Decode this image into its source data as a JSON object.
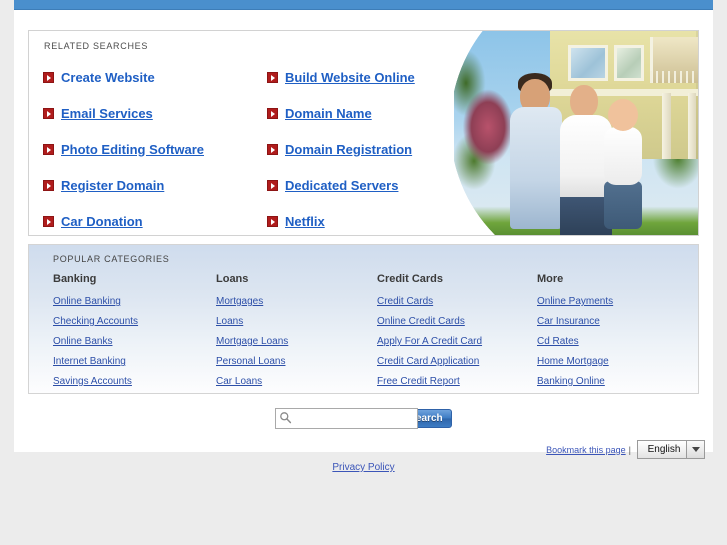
{
  "theme": {
    "topbar_color": "#4a8fcd",
    "link_color": "#1f5fc4",
    "bullet_color": "#b01c1c",
    "page_background": "#ececec",
    "panel_background": "#ffffff",
    "category_gradient_top": "#cfdced",
    "category_gradient_bottom": "#fdfdfe",
    "search_button_color": "#3d7cc4"
  },
  "related": {
    "title": "RELATED SEARCHES",
    "left_column": [
      {
        "label": "Create Website"
      },
      {
        "label": "Email Services"
      },
      {
        "label": "Photo Editing Software"
      },
      {
        "label": "Register Domain"
      },
      {
        "label": "Car Donation"
      }
    ],
    "right_column": [
      {
        "label": "Build Website Online"
      },
      {
        "label": "Domain Name"
      },
      {
        "label": "Domain Registration"
      },
      {
        "label": "Dedicated Servers"
      },
      {
        "label": "Netflix"
      }
    ]
  },
  "hero": {
    "image_alt": "family-with-baby-in-front-of-house-photo"
  },
  "categories": {
    "title": "POPULAR CATEGORIES",
    "columns": [
      {
        "heading": "Banking",
        "links": [
          "Online Banking",
          "Checking Accounts",
          "Online Banks",
          "Internet Banking",
          "Savings Accounts"
        ]
      },
      {
        "heading": "Loans",
        "links": [
          "Mortgages",
          "Loans",
          "Mortgage Loans",
          "Personal Loans",
          "Car Loans"
        ]
      },
      {
        "heading": "Credit Cards",
        "links": [
          "Credit Cards",
          "Online Credit Cards",
          "Apply For A Credit Card",
          "Credit Card Application",
          "Free Credit Report"
        ]
      },
      {
        "heading": "More",
        "links": [
          "Online Payments",
          "Car Insurance",
          "Cd Rates",
          "Home Mortgage",
          "Banking Online"
        ]
      }
    ]
  },
  "search": {
    "value": "",
    "placeholder": "",
    "button_label": "Search",
    "icon": "magnifier-icon"
  },
  "footer": {
    "bookmark_label": "Bookmark this page",
    "separator": "|",
    "language_value": "English",
    "language_options": [
      "English"
    ],
    "privacy_label": "Privacy Policy"
  }
}
